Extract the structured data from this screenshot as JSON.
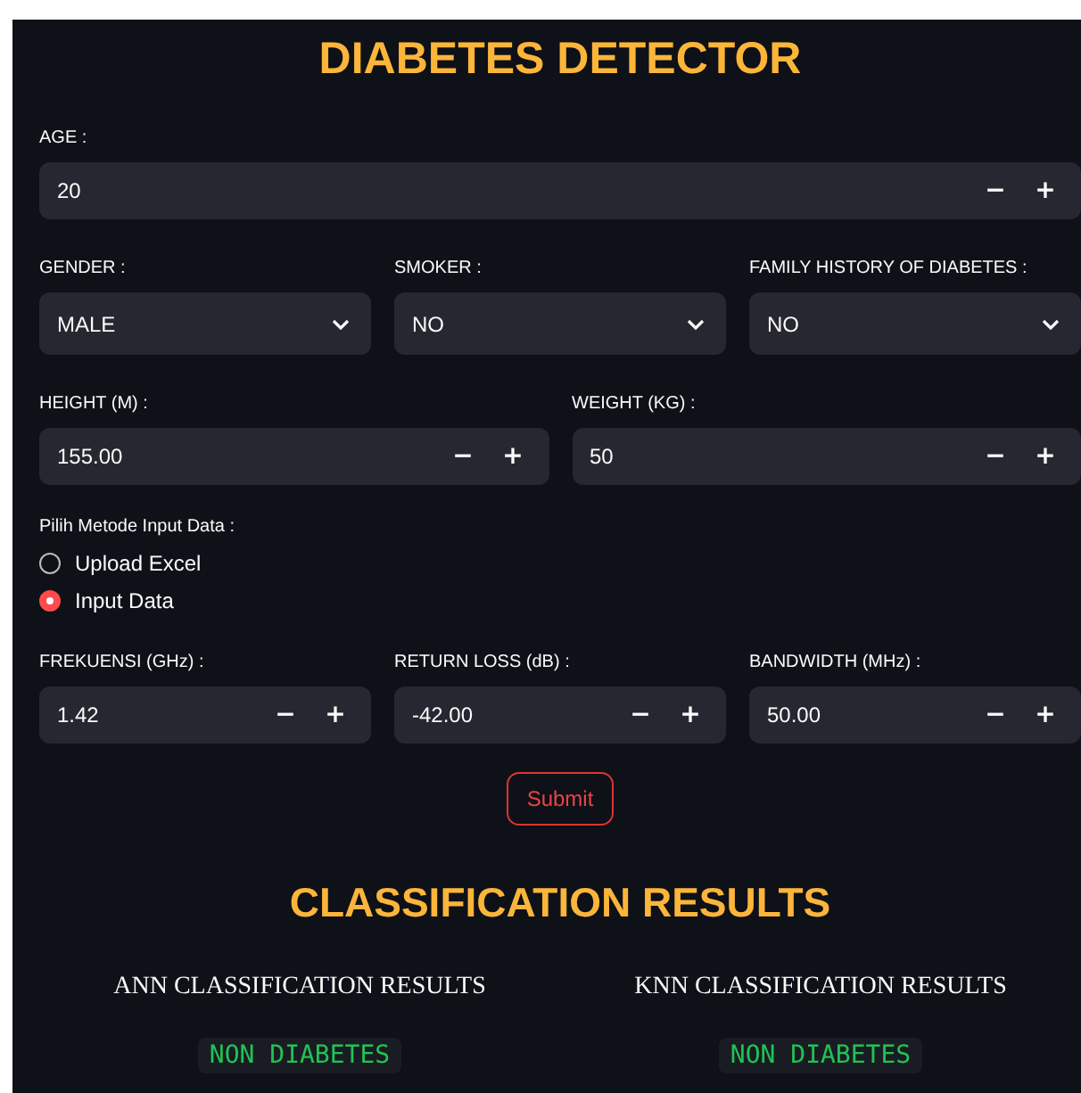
{
  "title": "DIABETES DETECTOR",
  "age": {
    "label": "AGE :",
    "value": "20",
    "minus": "−",
    "plus": "+"
  },
  "selects": [
    {
      "label": "GENDER :",
      "value": "MALE"
    },
    {
      "label": "SMOKER :",
      "value": "NO"
    },
    {
      "label": "FAMILY HISTORY OF DIABETES :",
      "value": "NO"
    }
  ],
  "body": [
    {
      "label": "HEIGHT (M) :",
      "value": "155.00",
      "minus": "−",
      "plus": "+"
    },
    {
      "label": "WEIGHT (KG) :",
      "value": "50",
      "minus": "−",
      "plus": "+"
    }
  ],
  "method": {
    "label": "Pilih Metode Input Data :",
    "options": [
      {
        "label": "Upload Excel",
        "selected": false
      },
      {
        "label": "Input Data",
        "selected": true
      }
    ]
  },
  "signal": [
    {
      "label": "FREKUENSI (GHz) :",
      "value": "1.42",
      "minus": "−",
      "plus": "+"
    },
    {
      "label": "RETURN LOSS (dB) :",
      "value": "-42.00",
      "minus": "−",
      "plus": "+"
    },
    {
      "label": "BANDWIDTH (MHz) :",
      "value": "50.00",
      "minus": "−",
      "plus": "+"
    }
  ],
  "submit": "Submit",
  "results_title": "CLASSIFICATION RESULTS",
  "results": [
    {
      "heading": "ANN CLASSIFICATION RESULTS",
      "value": "NON DIABETES"
    },
    {
      "heading": "KNN CLASSIFICATION RESULTS",
      "value": "NON DIABETES"
    }
  ]
}
